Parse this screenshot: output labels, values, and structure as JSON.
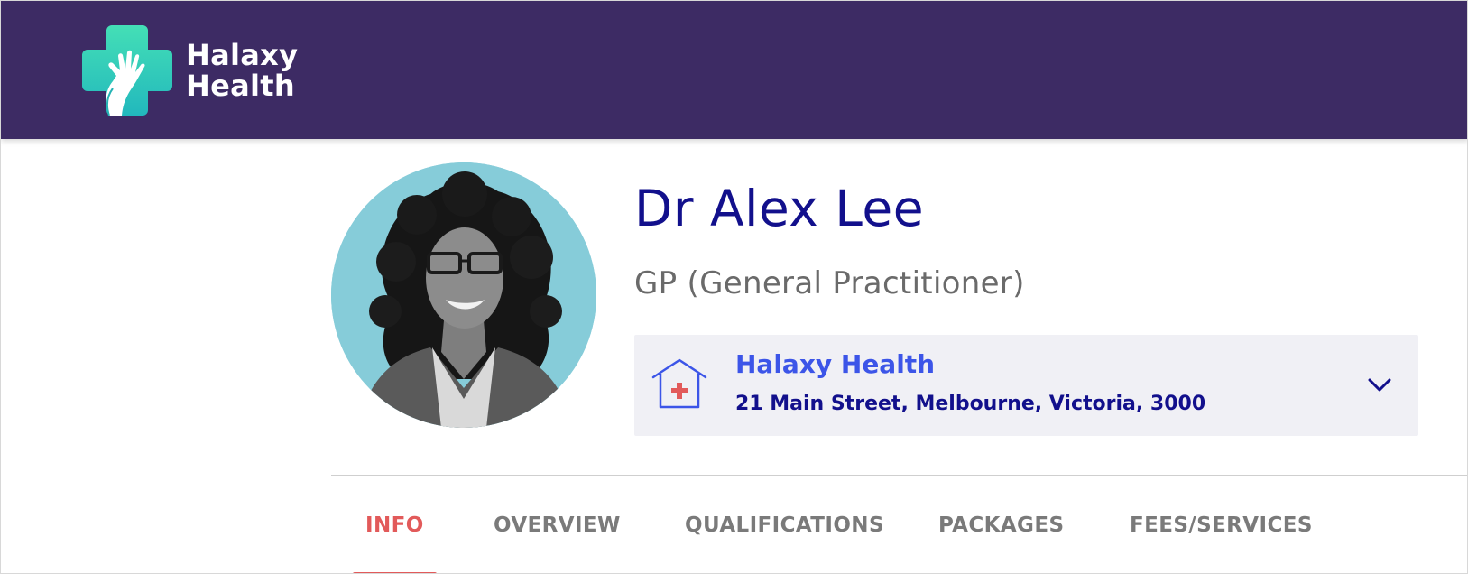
{
  "header": {
    "logo_line1": "Halaxy",
    "logo_line2": "Health",
    "background_color": "#3d2b64",
    "logo_icon": "cross-hand-icon"
  },
  "profile": {
    "name": "Dr Alex Lee",
    "specialty": "GP (General Practitioner)",
    "avatar_icon": "practitioner-photo"
  },
  "location": {
    "clinic_name": "Halaxy Health",
    "address": "21 Main Street, Melbourne, Victoria, 3000",
    "icon": "clinic-house-icon",
    "toggle_icon": "chevron-down-icon"
  },
  "tabs": [
    {
      "label": "INFO",
      "active": true
    },
    {
      "label": "OVERVIEW",
      "active": false
    },
    {
      "label": "QUALIFICATIONS",
      "active": false
    },
    {
      "label": "PACKAGES",
      "active": false
    },
    {
      "label": "FEES/SERVICES",
      "active": false
    }
  ],
  "colors": {
    "name": "#12108c",
    "clinic_link": "#3c55e8",
    "active_tab": "#e25a5a",
    "inactive_tab": "#7a7a7a"
  }
}
